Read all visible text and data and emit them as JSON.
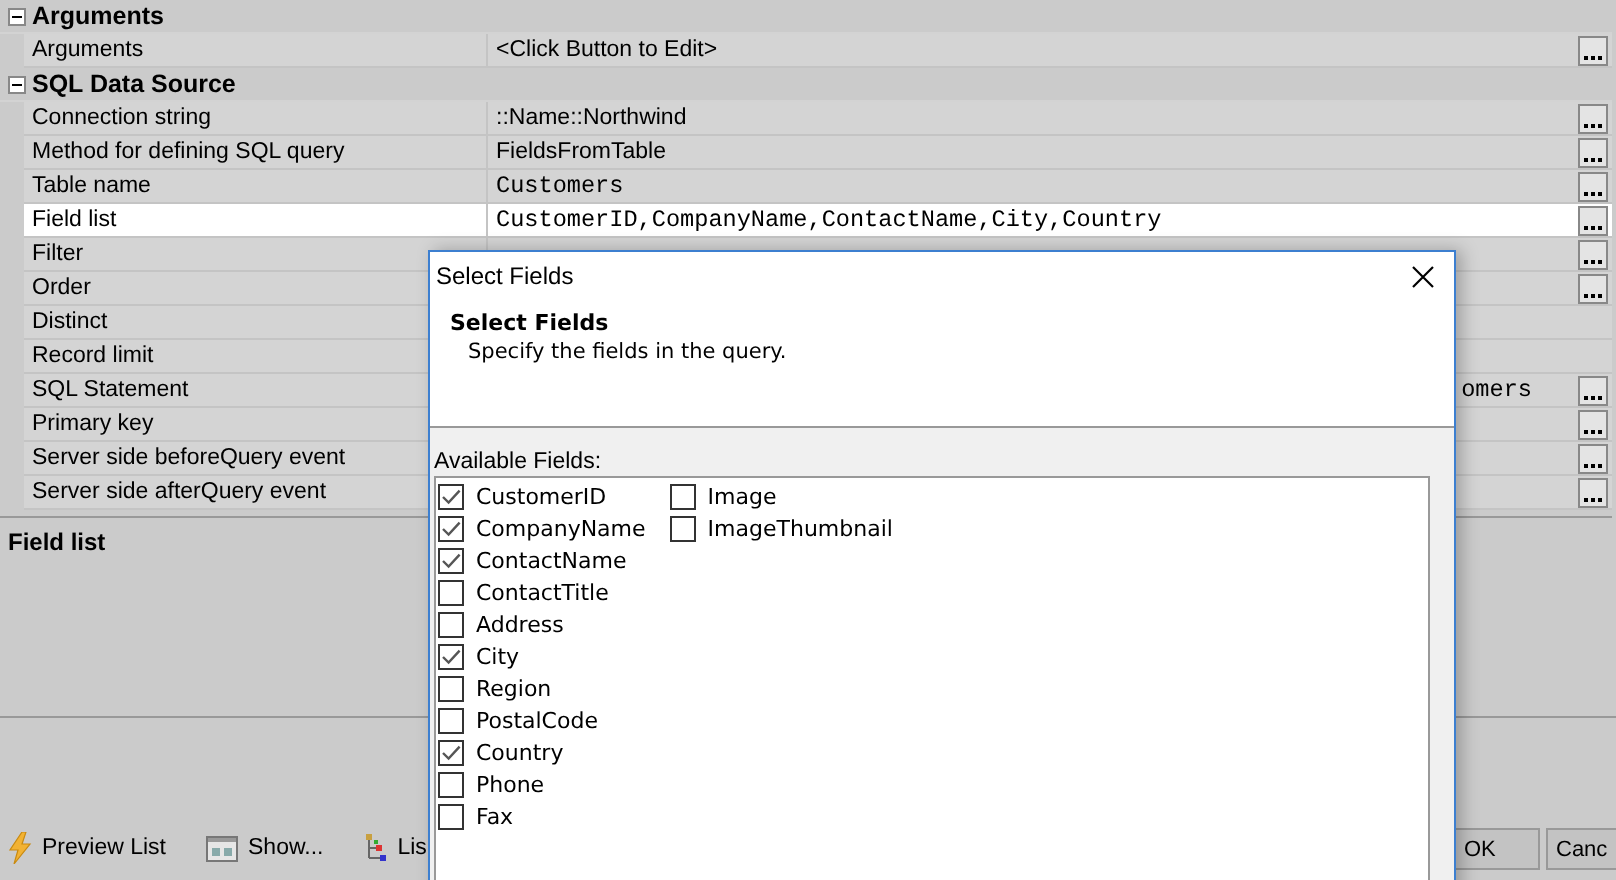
{
  "property_grid": {
    "categories": [
      {
        "name": "Arguments",
        "expanded": true,
        "properties": [
          {
            "name": "Arguments",
            "value": "<Click Button to Edit>",
            "kind": "text",
            "has_edit_button": true,
            "selected": false
          }
        ]
      },
      {
        "name": "SQL Data Source",
        "expanded": true,
        "properties": [
          {
            "name": "Connection string",
            "value": "::Name::Northwind",
            "kind": "text",
            "has_edit_button": true,
            "selected": false
          },
          {
            "name": "Method for defining SQL query",
            "value": "FieldsFromTable",
            "kind": "text",
            "has_edit_button": true,
            "selected": false
          },
          {
            "name": "Table name",
            "value": "Customers",
            "kind": "code",
            "has_edit_button": true,
            "selected": false
          },
          {
            "name": "Field list",
            "value": "CustomerID,CompanyName,ContactName,City,Country",
            "kind": "code",
            "has_edit_button": true,
            "selected": true
          },
          {
            "name": "Filter",
            "has_edit_button": true,
            "selected": false
          },
          {
            "name": "Order",
            "has_edit_button": true,
            "selected": false
          },
          {
            "name": "Distinct",
            "has_edit_button": false,
            "selected": false
          },
          {
            "name": "Record limit",
            "has_edit_button": false,
            "selected": false
          },
          {
            "name": "SQL Statement",
            "value": "omers",
            "kind": "code-tail",
            "has_edit_button": true,
            "selected": false
          },
          {
            "name": "Primary key",
            "has_edit_button": true,
            "selected": false
          },
          {
            "name": "Server side beforeQuery event",
            "has_edit_button": true,
            "selected": false
          },
          {
            "name": "Server side afterQuery event",
            "has_edit_button": true,
            "selected": false
          }
        ]
      }
    ]
  },
  "description": {
    "title": "Field list"
  },
  "toolbar": [
    "Preview List",
    "Show...",
    "Lis"
  ],
  "buttons": [
    "OK",
    "Canc"
  ],
  "dialog": {
    "title": "Select Fields",
    "header_title": "Select Fields",
    "header_description": "Specify the fields in the query.",
    "fields_label": "Available Fields:",
    "fields": [
      {
        "name": "CustomerID",
        "checked": true
      },
      {
        "name": "CompanyName",
        "checked": true
      },
      {
        "name": "ContactName",
        "checked": true
      },
      {
        "name": "ContactTitle",
        "checked": false
      },
      {
        "name": "Address",
        "checked": false
      },
      {
        "name": "City",
        "checked": true
      },
      {
        "name": "Region",
        "checked": false
      },
      {
        "name": "PostalCode",
        "checked": false
      },
      {
        "name": "Country",
        "checked": true
      },
      {
        "name": "Phone",
        "checked": false
      },
      {
        "name": "Fax",
        "checked": false
      },
      {
        "name": "Image",
        "checked": false
      },
      {
        "name": "ImageThumbnail",
        "checked": false
      }
    ]
  }
}
